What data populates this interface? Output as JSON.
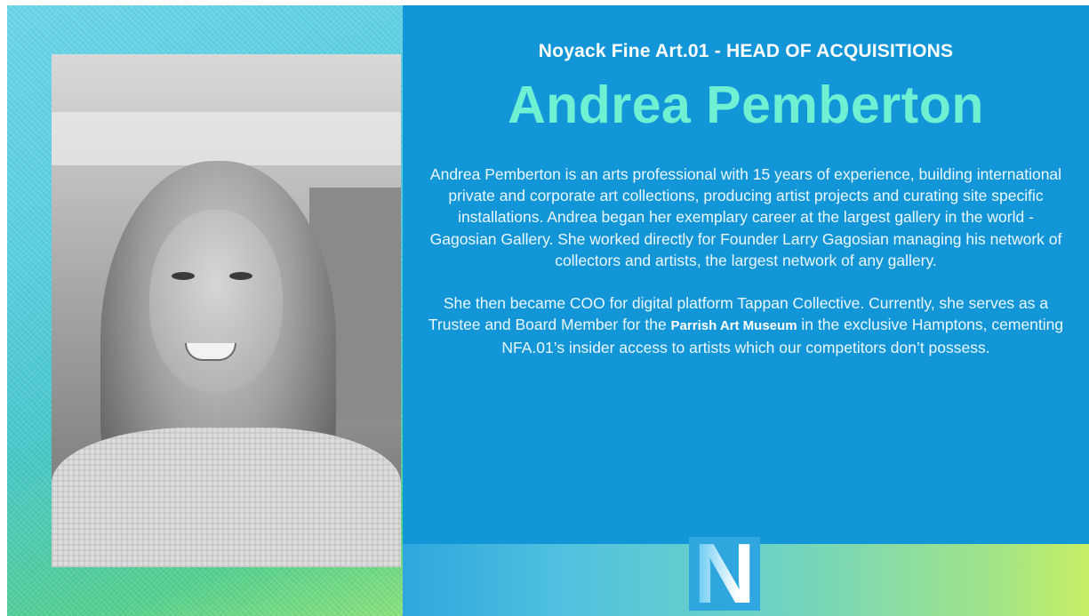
{
  "header": {
    "subtitle": "Noyack Fine Art.01 - HEAD OF ACQUISITIONS",
    "name": "Andrea Pemberton"
  },
  "bio": {
    "paragraph_1": "Andrea Pemberton is an arts professional with 15 years of experience, building international private and corporate art collections, producing artist projects and curating site specific installations. Andrea began her exemplary career at the largest gallery in the world -  Gagosian Gallery. She worked directly for Founder Larry Gagosian  managing his network of collectors and artists, the largest network of any gallery.",
    "paragraph_2_before": "She then became COO for digital platform Tappan Collective. Currently, she serves as a Trustee and Board Member for the ",
    "paragraph_2_bold": "Parrish Art Museum",
    "paragraph_2_after": " in the exclusive Hamptons, cementing NFA.01’s insider access to artists which our competitors don’t possess."
  },
  "logo": {
    "letter": "N"
  },
  "colors": {
    "background": "#1296d8",
    "name_accent": "#6ff0d3",
    "gradient_green": "#c6ef64"
  }
}
